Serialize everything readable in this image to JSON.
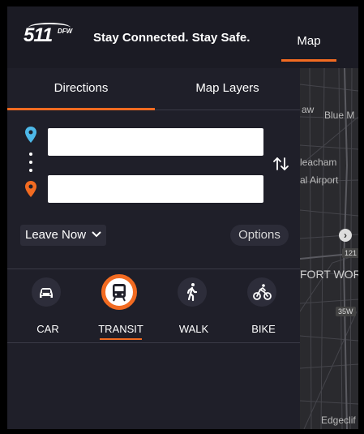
{
  "header": {
    "logo_number": "511",
    "logo_sub": "DFW",
    "tagline": "Stay Connected. Stay Safe.",
    "map_tab": "Map"
  },
  "tabs": {
    "directions": "Directions",
    "map_layers": "Map Layers"
  },
  "form": {
    "origin_value": "",
    "destination_value": "",
    "leave_label": "Leave Now",
    "options_label": "Options"
  },
  "modes": [
    {
      "label": "CAR",
      "icon": "car-icon",
      "active": false
    },
    {
      "label": "TRANSIT",
      "icon": "transit-icon",
      "active": true
    },
    {
      "label": "WALK",
      "icon": "walk-icon",
      "active": false
    },
    {
      "label": "BIKE",
      "icon": "bike-icon",
      "active": false
    }
  ],
  "map": {
    "labels": [
      "aw",
      "Blue M",
      "leacham",
      "al Airport",
      "121",
      "FORT WOR",
      "35W",
      "Edgeclif"
    ]
  },
  "colors": {
    "accent": "#f26b21",
    "origin_pin": "#4db8e8",
    "destination_pin": "#f26b21",
    "panel_bg": "#1f1f29"
  }
}
